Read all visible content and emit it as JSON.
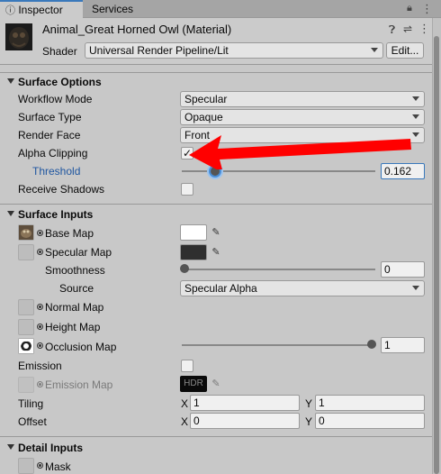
{
  "tabs": {
    "inspector": "Inspector",
    "services": "Services"
  },
  "header": {
    "material_name": "Animal_Great Horned Owl (Material)",
    "shader_label": "Shader",
    "shader_value": "Universal Render Pipeline/Lit",
    "edit_button": "Edit..."
  },
  "surface_options": {
    "title": "Surface Options",
    "workflow_mode_label": "Workflow Mode",
    "workflow_mode_value": "Specular",
    "surface_type_label": "Surface Type",
    "surface_type_value": "Opaque",
    "render_face_label": "Render Face",
    "render_face_value": "Front",
    "alpha_clipping_label": "Alpha Clipping",
    "alpha_clipping_checked": true,
    "checkmark": "✓",
    "threshold_label": "Threshold",
    "threshold_value": "0.162",
    "receive_shadows_label": "Receive Shadows",
    "receive_shadows_checked": false
  },
  "surface_inputs": {
    "title": "Surface Inputs",
    "base_map_label": "Base Map",
    "base_map_color": "#ffffff",
    "specular_map_label": "Specular Map",
    "specular_map_color": "#2f2f2f",
    "smoothness_label": "Smoothness",
    "smoothness_value": "0",
    "source_label": "Source",
    "source_value": "Specular Alpha",
    "normal_map_label": "Normal Map",
    "height_map_label": "Height Map",
    "occlusion_map_label": "Occlusion Map",
    "occlusion_value": "1",
    "emission_label": "Emission",
    "emission_map_label": "Emission Map",
    "emission_hdr": "HDR",
    "tiling_label": "Tiling",
    "tiling_x_label": "X",
    "tiling_x": "1",
    "tiling_y_label": "Y",
    "tiling_y": "1",
    "offset_label": "Offset",
    "offset_x_label": "X",
    "offset_x": "0",
    "offset_y_label": "Y",
    "offset_y": "0"
  },
  "detail_inputs": {
    "title": "Detail Inputs",
    "mask_label": "Mask"
  },
  "icons": [
    "inspector-icon",
    "lock-icon",
    "menu-icon",
    "help-icon",
    "preset-icon",
    "more-icon",
    "eyedropper-icon",
    "foldout-arrow-icon",
    "red-arrow-annotation"
  ],
  "colors": {
    "accent": "#3a79bb",
    "annotation": "#ff0000",
    "panel_bg": "#c8c8c8"
  }
}
